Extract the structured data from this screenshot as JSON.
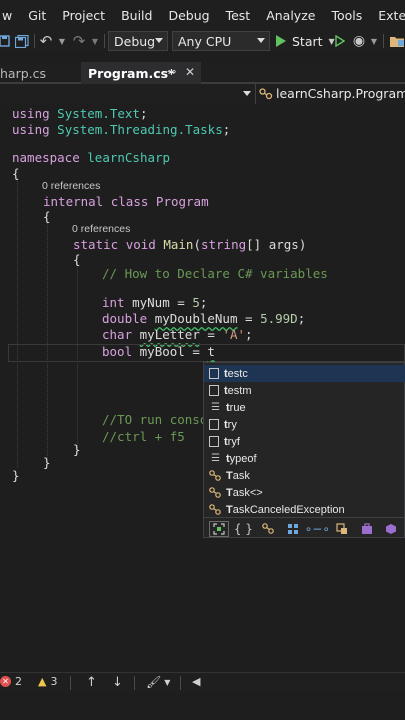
{
  "menu": [
    "w",
    "Git",
    "Project",
    "Build",
    "Debug",
    "Test",
    "Analyze",
    "Tools",
    "Extensions"
  ],
  "toolbar": {
    "config": "Debug",
    "platform": "Any CPU",
    "start_label": "Start"
  },
  "tabs": [
    {
      "label": "harp.cs",
      "active": false
    },
    {
      "label": "Program.cs*",
      "active": true
    }
  ],
  "navbar": {
    "member": "learnCsharp.Program"
  },
  "code": {
    "line1_kw": "using",
    "line1_ns": "System.Text",
    "line2_kw": "using",
    "line2_ns": "System.Threading.Tasks",
    "ns_kw": "namespace",
    "ns_name": "learnCsharp",
    "ref1": "0 references",
    "class_kw1": "internal",
    "class_kw2": "class",
    "class_name": "Program",
    "ref2": "0 references",
    "main_kw1": "static",
    "main_kw2": "void",
    "main_name": "Main",
    "main_args_type": "string",
    "main_args_name": "args",
    "comment1": "// How to Declare C# variables",
    "v1_type": "int",
    "v1_name": "myNum",
    "v1_val": "5",
    "v2_type": "double",
    "v2_name": "myDoubleNum",
    "v2_val": "5.99D",
    "v3_type": "char",
    "v3_name": "myLetter",
    "v3_val": "'A'",
    "v4_type": "bool",
    "v4_name": "myBool",
    "v4_val": "t",
    "comment2": "//TO run conso",
    "comment3": "//ctrl + f5"
  },
  "suggestions": [
    {
      "bold": "t",
      "rest": "estc",
      "icon": "snippet-icon",
      "selected": true
    },
    {
      "bold": "t",
      "rest": "estm",
      "icon": "snippet-icon",
      "selected": false
    },
    {
      "bold": "t",
      "rest": "rue",
      "icon": "keyword-icon",
      "selected": false
    },
    {
      "bold": "t",
      "rest": "ry",
      "icon": "snippet-icon",
      "selected": false
    },
    {
      "bold": "t",
      "rest": "ryf",
      "icon": "snippet-icon",
      "selected": false
    },
    {
      "bold": "t",
      "rest": "ypeof",
      "icon": "keyword-icon",
      "selected": false
    },
    {
      "bold": "T",
      "rest": "ask",
      "icon": "class-icon",
      "selected": false
    },
    {
      "bold": "T",
      "rest": "ask<>",
      "icon": "class-icon",
      "selected": false
    },
    {
      "bold": "T",
      "rest": "askCanceledException",
      "icon": "class-icon",
      "selected": false
    }
  ],
  "status": {
    "errors": "2",
    "warnings": "3"
  },
  "colors": {
    "keyword": "#569cd6",
    "type": "#4ec9b0",
    "number": "#b5cea8",
    "string": "#d69d85",
    "comment": "#6a9955",
    "selection": "#1d3452"
  }
}
